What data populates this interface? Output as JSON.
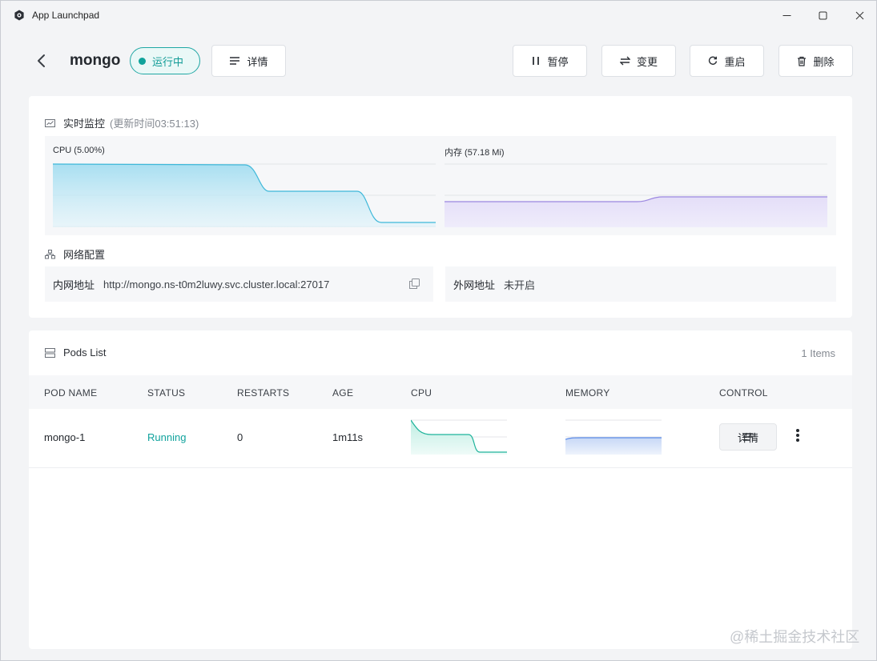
{
  "window": {
    "title": "App Launchpad"
  },
  "header": {
    "app_name": "mongo",
    "status": "运行中",
    "detail_label": "详情",
    "actions": {
      "pause": "暂停",
      "change": "变更",
      "restart": "重启",
      "delete": "删除"
    }
  },
  "monitor": {
    "title": "实时监控",
    "updated": "(更新时间03:51:13)",
    "cpu_label": "CPU  (5.00%)",
    "mem_label": "内存  (57.18 Mi)"
  },
  "network": {
    "title": "网络配置",
    "internal_key": "内网地址",
    "internal_value": "http://mongo.ns-t0m2luwy.svc.cluster.local:27017",
    "external_key": "外网地址",
    "external_value": "未开启"
  },
  "pods": {
    "title": "Pods List",
    "count": "1 Items",
    "columns": [
      "POD NAME",
      "STATUS",
      "RESTARTS",
      "AGE",
      "CPU",
      "MEMORY",
      "CONTROL"
    ],
    "rows": [
      {
        "name": "mongo-1",
        "status": "Running",
        "restarts": "0",
        "age": "1m11s",
        "detail_label": "详情"
      }
    ]
  },
  "colors": {
    "accent": "#11a39d",
    "cpu_line": "#3fb8d9",
    "mem_line": "#9b87e0",
    "pod_cpu_line": "#1fb39b",
    "pod_mem_line": "#5b8be8"
  },
  "watermark": "@稀土掘金技术社区"
}
